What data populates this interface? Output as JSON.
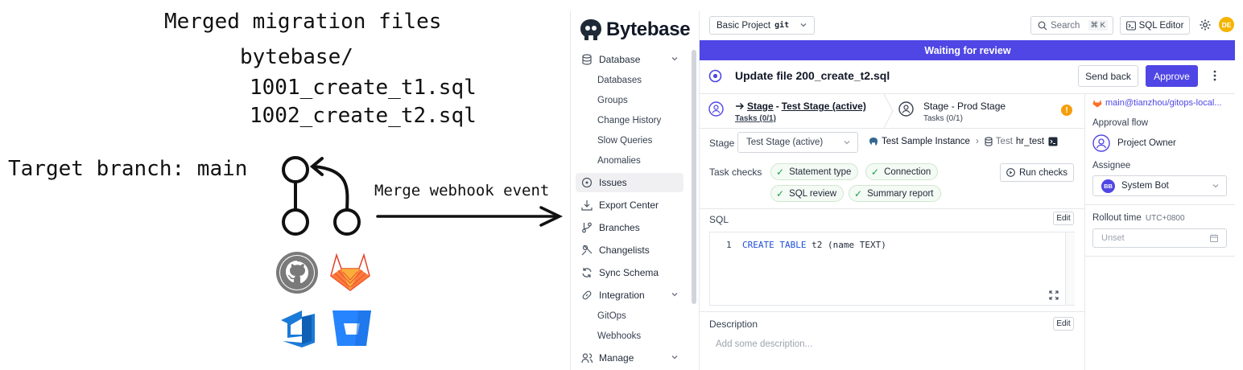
{
  "diagram": {
    "title": "Merged migration files",
    "folder": "bytebase/",
    "file1": "1001_create_t1.sql",
    "file2": "1002_create_t2.sql",
    "target_branch": "Target branch: main",
    "event": "Merge webhook event"
  },
  "app": {
    "brand": "Bytebase",
    "sidebar": {
      "database": "Database",
      "databases": "Databases",
      "groups": "Groups",
      "change_history": "Change History",
      "slow_queries": "Slow Queries",
      "anomalies": "Anomalies",
      "issues": "Issues",
      "export_center": "Export Center",
      "branches": "Branches",
      "changelists": "Changelists",
      "sync_schema": "Sync Schema",
      "integration": "Integration",
      "gitops": "GitOps",
      "webhooks": "Webhooks",
      "manage": "Manage"
    },
    "topbar": {
      "project": "Basic Project",
      "project_tag": "git",
      "search_placeholder": "Search",
      "search_shortcut": "⌘ K",
      "sql_editor": "SQL Editor",
      "avatar": "DE"
    },
    "banner": "Waiting for review",
    "issue": {
      "title": "Update file 200_create_t2.sql",
      "send_back": "Send back",
      "approve": "Approve"
    },
    "stages": {
      "stage1_prefix": "Stage",
      "stage1_name": "Test Stage (active)",
      "stage1_tasks": "Tasks (0/1)",
      "stage2": "Stage - Prod Stage",
      "stage2_tasks": "Tasks (0/1)"
    },
    "stage_row": {
      "label": "Stage",
      "select": "Test Stage (active)",
      "instance": "Test Sample Instance",
      "env": "Test",
      "db": "hr_test"
    },
    "checks": {
      "label": "Task checks",
      "statement_type": "Statement type",
      "connection": "Connection",
      "sql_review": "SQL review",
      "summary_report": "Summary report",
      "run_checks": "Run checks"
    },
    "sql": {
      "label": "SQL",
      "edit": "Edit",
      "line_no": "1",
      "kw": "CREATE TABLE",
      "rest": " t2 (name TEXT)"
    },
    "description": {
      "label": "Description",
      "edit": "Edit",
      "placeholder": "Add some description..."
    },
    "right": {
      "repo": "main@tianzhou/gitops-local...",
      "approval_flow": "Approval flow",
      "project_owner": "Project Owner",
      "assignee": "Assignee",
      "assignee_avatar": "BB",
      "assignee_name": "System Bot",
      "rollout_time": "Rollout time",
      "tz": "UTC+0800",
      "unset": "Unset"
    }
  }
}
